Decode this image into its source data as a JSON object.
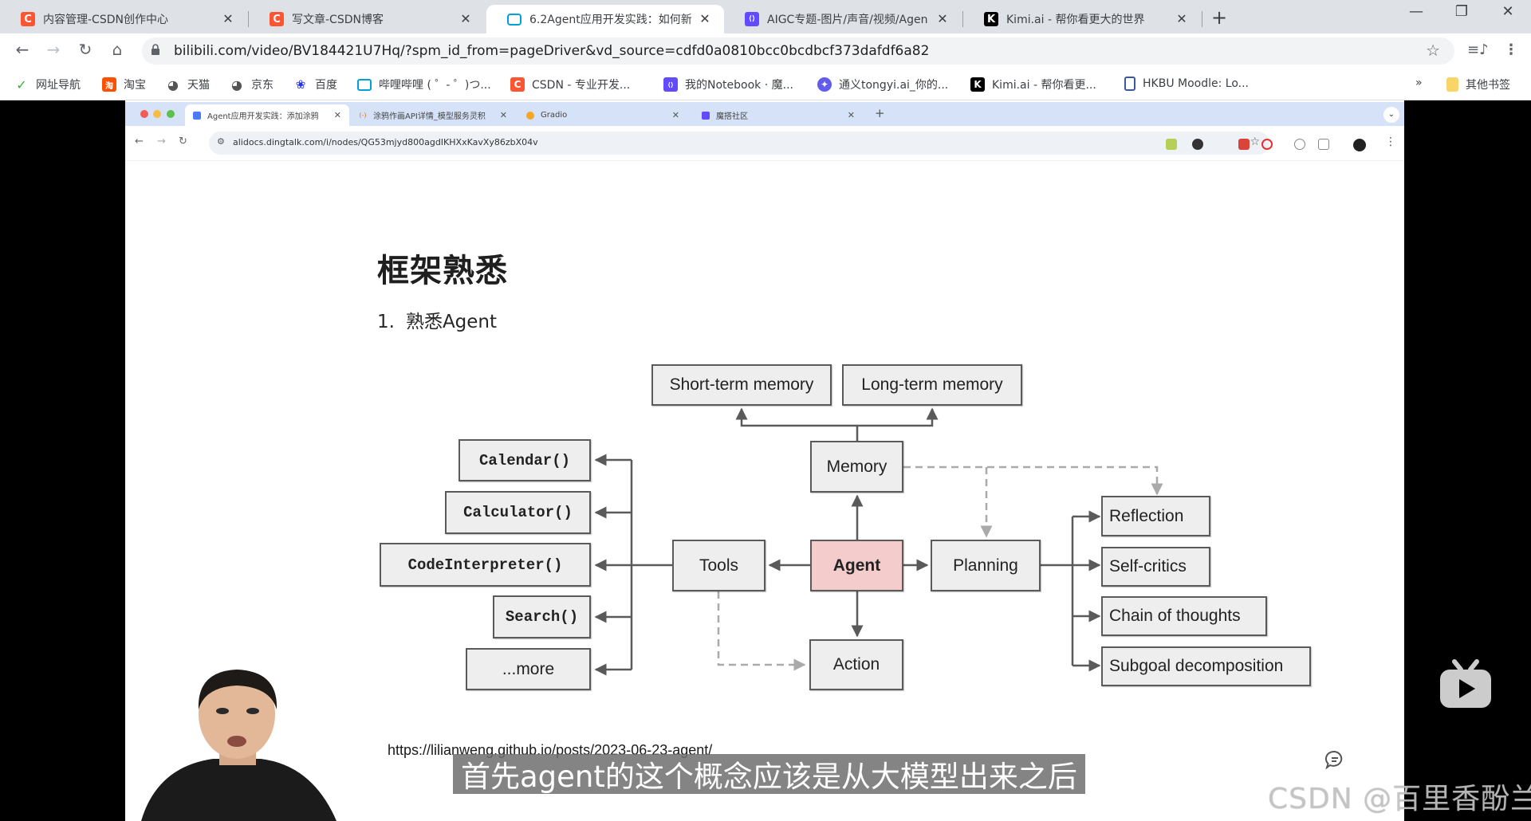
{
  "browser": {
    "tabs": [
      {
        "label": "内容管理-CSDN创作中心",
        "icon": "csdn-icon",
        "icon_color": "#fc5531",
        "icon_glyph": "C"
      },
      {
        "label": "写文章-CSDN博客",
        "icon": "csdn-icon",
        "icon_color": "#fc5531",
        "icon_glyph": "C"
      },
      {
        "label": "6.2Agent应用开发实践：如何新",
        "icon": "bilibili-icon",
        "icon_color": "#00a1d6",
        "icon_glyph": "▭",
        "active": true
      },
      {
        "label": "AIGC专题-图片/声音/视频/Agen",
        "icon": "modelscope-icon",
        "icon_color": "#624aff",
        "icon_glyph": "⟨⟩"
      },
      {
        "label": "Kimi.ai - 帮你看更大的世界",
        "icon": "kimi-icon",
        "icon_color": "#000000",
        "icon_glyph": "K"
      }
    ],
    "new_tab": "+",
    "window_controls": {
      "minimize": "—",
      "restore": "❐",
      "close": "✕"
    },
    "address_url": "bilibili.com/video/BV184421U7Hq/?spm_id_from=pageDriver&vd_source=cdfd0a0810bcc0bcdbcf373dafdf6a82",
    "bookmarks": [
      {
        "label": "网址导航",
        "icon": "hao-icon",
        "color": "#3cb034",
        "glyph": "✓"
      },
      {
        "label": "淘宝",
        "icon": "taobao-icon",
        "color": "#ff5000",
        "glyph": "淘"
      },
      {
        "label": "天猫",
        "icon": "globe-icon",
        "color": "#555555",
        "glyph": "◕"
      },
      {
        "label": "京东",
        "icon": "globe-icon",
        "color": "#555555",
        "glyph": "◕"
      },
      {
        "label": "百度",
        "icon": "baidu-icon",
        "color": "#2932e1",
        "glyph": "❀"
      },
      {
        "label": "哔哩哔哩 ( ゜- ゜)つ...",
        "icon": "bilibili-icon",
        "color": "#00a1d6",
        "glyph": "▭"
      },
      {
        "label": "CSDN - 专业开发...",
        "icon": "csdn-icon",
        "color": "#fc5531",
        "glyph": "C"
      },
      {
        "label": "我的Notebook · 魔...",
        "icon": "modelscope-icon",
        "color": "#624aff",
        "glyph": "⟨⟩"
      },
      {
        "label": "通义tongyi.ai_你的...",
        "icon": "tongyi-icon",
        "color": "#615ced",
        "glyph": "✦"
      },
      {
        "label": "Kimi.ai - 帮你看更...",
        "icon": "kimi-icon",
        "color": "#000000",
        "glyph": "K"
      },
      {
        "label": "HKBU Moodle: Lo...",
        "icon": "moodle-icon",
        "color": "#3b5998",
        "glyph": "▯"
      }
    ],
    "bookmarks_overflow": "»",
    "other_bookmarks": "其他书签"
  },
  "video": {
    "inner_browser": {
      "tabs": [
        {
          "label": "Agent应用开发实践：添加涂鸦",
          "active": true,
          "icon_color": "#4a7cf7"
        },
        {
          "label": "涂鸦作画API详情_模型服务灵积",
          "icon_color": "#ff6a00"
        },
        {
          "label": "Gradio",
          "icon_color": "#f5a623"
        },
        {
          "label": "魔搭社区",
          "icon_color": "#624aff"
        }
      ],
      "url": "alidocs.dingtalk.com/i/nodes/QG53mjyd800agdIKHXxKavXy86zbX04v"
    },
    "doc": {
      "title": "框架熟悉",
      "list_item_number": "1.",
      "list_item_text": "熟悉Agent",
      "reference_url": "https://lilianweng.github.io/posts/2023-06-23-agent/"
    },
    "diagram": {
      "nodes": {
        "short_term_memory": "Short-term memory",
        "long_term_memory": "Long-term memory",
        "memory": "Memory",
        "agent": "Agent",
        "tools": "Tools",
        "planning": "Planning",
        "action": "Action",
        "calendar": "Calendar()",
        "calculator": "Calculator()",
        "code_interpreter": "CodeInterpreter()",
        "search": "Search()",
        "more": "...more",
        "reflection": "Reflection",
        "self_critics": "Self-critics",
        "chain_of_thoughts": "Chain of thoughts",
        "subgoal_decomposition": "Subgoal decomposition"
      },
      "agent_color": "#f4cccc",
      "box_color": "#eeeeee"
    },
    "subtitle": "首先agent的这个概念应该是从大模型出来之后",
    "watermark": "CSDN @百里香酚兰",
    "bili_watermark": "bilibili"
  }
}
